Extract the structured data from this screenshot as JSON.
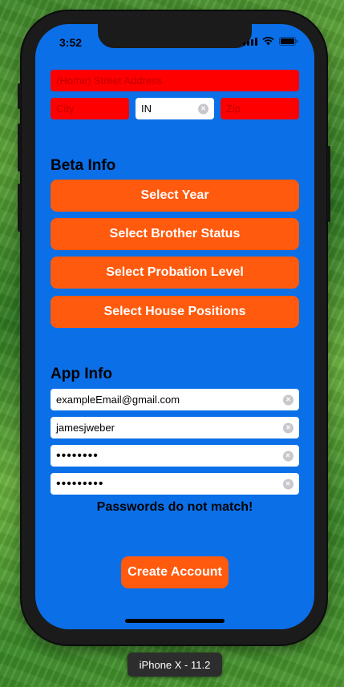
{
  "status_bar": {
    "time": "3:52"
  },
  "address": {
    "street_placeholder": "(Home) Street Address",
    "city_placeholder": "City",
    "state_value": "IN",
    "zip_placeholder": "Zip"
  },
  "beta_info": {
    "title": "Beta Info",
    "buttons": [
      {
        "label": "Select Year"
      },
      {
        "label": "Select Brother Status"
      },
      {
        "label": "Select Probation Level"
      },
      {
        "label": "Select House Positions"
      }
    ]
  },
  "app_info": {
    "title": "App Info",
    "email_value": "exampleEmail@gmail.com",
    "username_value": "jamesjweber",
    "password_value": "••••••••",
    "confirm_password_value": "•••••••••",
    "error_message": "Passwords do not match!"
  },
  "create_account_label": "Create Account",
  "simulator_label": "iPhone X - 11.2",
  "colors": {
    "screen_background": "#0b6fe8",
    "invalid_field": "#ff0000",
    "accent_button": "#ff5a0d"
  }
}
